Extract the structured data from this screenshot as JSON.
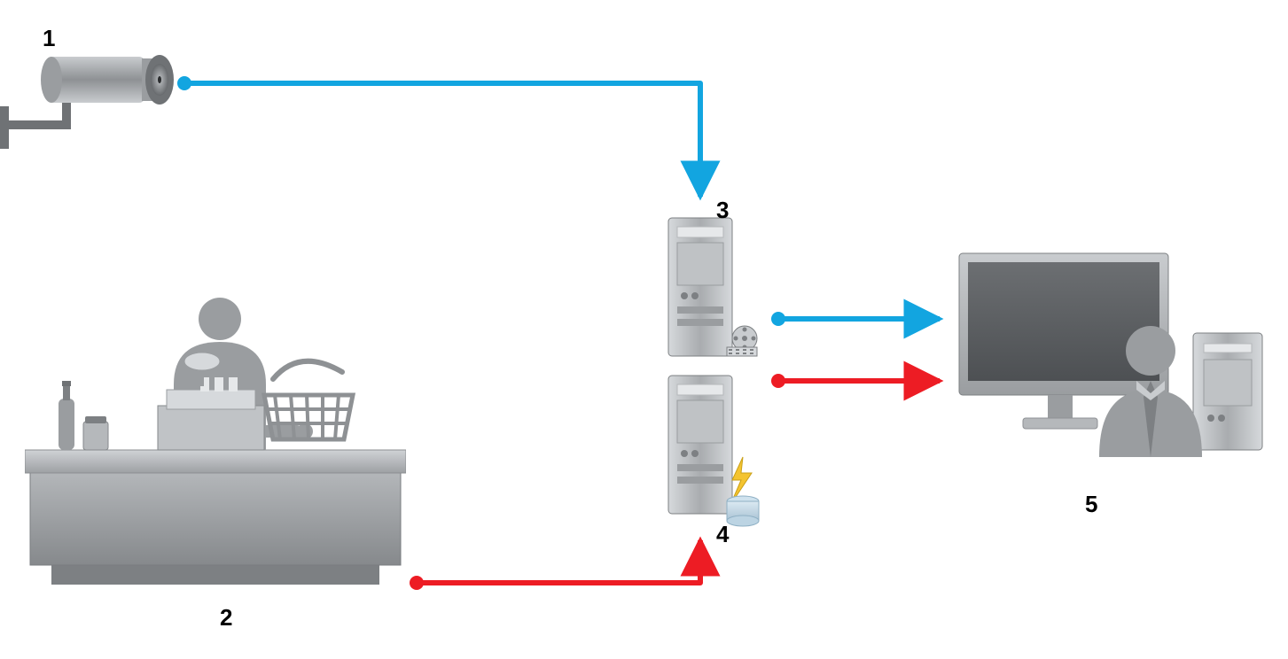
{
  "diagram": {
    "nodes": {
      "camera": {
        "label": "1"
      },
      "pos": {
        "label": "2"
      },
      "server_a": {
        "label": "3"
      },
      "server_b": {
        "label": "4"
      },
      "operator": {
        "label": "5"
      }
    },
    "colors": {
      "video": "#12a5e0",
      "data": "#ed1c24",
      "gray_dark": "#6f7275",
      "gray_mid": "#9a9da0",
      "gray_light": "#c4c7c9"
    },
    "flows": [
      {
        "from": "camera",
        "to": "server_a",
        "color": "video"
      },
      {
        "from": "pos",
        "to": "server_b",
        "color": "data"
      },
      {
        "from": "server_a",
        "to": "operator",
        "color": "video"
      },
      {
        "from": "server_b",
        "to": "operator",
        "color": "data"
      }
    ]
  }
}
